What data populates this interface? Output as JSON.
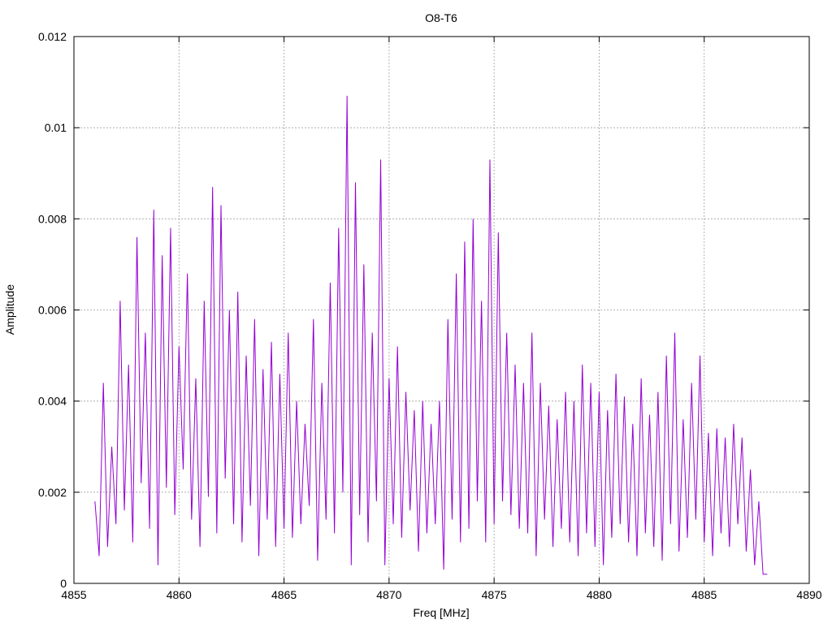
{
  "chart_data": {
    "type": "line",
    "title": "O8-T6",
    "xlabel": "Freq [MHz]",
    "ylabel": "Amplitude",
    "xlim": [
      4855,
      4890
    ],
    "ylim": [
      0,
      0.012
    ],
    "xticks": [
      4855,
      4860,
      4865,
      4870,
      4875,
      4880,
      4885,
      4890
    ],
    "xtick_labels": [
      "4855",
      "4860",
      "4865",
      "4870",
      "4875",
      "4880",
      "4885",
      "4890"
    ],
    "yticks": [
      0,
      0.002,
      0.004,
      0.006,
      0.008,
      0.01,
      0.012
    ],
    "ytick_labels": [
      "0",
      "0.002",
      "0.004",
      "0.006",
      "0.008",
      "0.01",
      "0.012"
    ],
    "grid": true,
    "legend": "none",
    "series": [
      {
        "color": "#9400d3",
        "x": [
          4856.0,
          4856.2,
          4856.4,
          4856.6,
          4856.8,
          4857.0,
          4857.2,
          4857.4,
          4857.6,
          4857.8,
          4858.0,
          4858.2,
          4858.4,
          4858.6,
          4858.8,
          4859.0,
          4859.2,
          4859.4,
          4859.6,
          4859.8,
          4860.0,
          4860.2,
          4860.4,
          4860.6,
          4860.8,
          4861.0,
          4861.2,
          4861.4,
          4861.6,
          4861.8,
          4862.0,
          4862.2,
          4862.4,
          4862.6,
          4862.8,
          4863.0,
          4863.2,
          4863.4,
          4863.6,
          4863.8,
          4864.0,
          4864.2,
          4864.4,
          4864.6,
          4864.8,
          4865.0,
          4865.2,
          4865.4,
          4865.6,
          4865.8,
          4866.0,
          4866.2,
          4866.4,
          4866.6,
          4866.8,
          4867.0,
          4867.2,
          4867.4,
          4867.6,
          4867.8,
          4868.0,
          4868.2,
          4868.4,
          4868.6,
          4868.8,
          4869.0,
          4869.2,
          4869.4,
          4869.6,
          4869.8,
          4870.0,
          4870.2,
          4870.4,
          4870.6,
          4870.8,
          4871.0,
          4871.2,
          4871.4,
          4871.6,
          4871.8,
          4872.0,
          4872.2,
          4872.4,
          4872.6,
          4872.8,
          4873.0,
          4873.2,
          4873.4,
          4873.6,
          4873.8,
          4874.0,
          4874.2,
          4874.4,
          4874.6,
          4874.8,
          4875.0,
          4875.2,
          4875.4,
          4875.6,
          4875.8,
          4876.0,
          4876.2,
          4876.4,
          4876.6,
          4876.8,
          4877.0,
          4877.2,
          4877.4,
          4877.6,
          4877.8,
          4878.0,
          4878.2,
          4878.4,
          4878.6,
          4878.8,
          4879.0,
          4879.2,
          4879.4,
          4879.6,
          4879.8,
          4880.0,
          4880.2,
          4880.4,
          4880.6,
          4880.8,
          4881.0,
          4881.2,
          4881.4,
          4881.6,
          4881.8,
          4882.0,
          4882.2,
          4882.4,
          4882.6,
          4882.8,
          4883.0,
          4883.2,
          4883.4,
          4883.6,
          4883.8,
          4884.0,
          4884.2,
          4884.4,
          4884.6,
          4884.8,
          4885.0,
          4885.2,
          4885.4,
          4885.6,
          4885.8,
          4886.0,
          4886.2,
          4886.4,
          4886.6,
          4886.8,
          4887.0,
          4887.2,
          4887.4,
          4887.6,
          4887.8,
          4888.0
        ],
        "y": [
          0.0018,
          0.0006,
          0.0044,
          0.0008,
          0.003,
          0.0013,
          0.0062,
          0.0016,
          0.0048,
          0.0009,
          0.0076,
          0.0022,
          0.0055,
          0.0012,
          0.0082,
          0.0004,
          0.0072,
          0.0021,
          0.0078,
          0.0015,
          0.0052,
          0.0025,
          0.0068,
          0.0014,
          0.0045,
          0.0008,
          0.0062,
          0.0019,
          0.0087,
          0.0011,
          0.0083,
          0.0023,
          0.006,
          0.0013,
          0.0064,
          0.0009,
          0.005,
          0.0017,
          0.0058,
          0.0006,
          0.0047,
          0.0014,
          0.0053,
          0.0008,
          0.0046,
          0.0012,
          0.0055,
          0.001,
          0.004,
          0.0013,
          0.0035,
          0.0017,
          0.0058,
          0.0005,
          0.0044,
          0.0014,
          0.0066,
          0.0011,
          0.0078,
          0.002,
          0.0107,
          0.0004,
          0.0088,
          0.0015,
          0.007,
          0.0009,
          0.0055,
          0.0018,
          0.0093,
          0.0004,
          0.0045,
          0.0013,
          0.0052,
          0.001,
          0.0042,
          0.0016,
          0.0038,
          0.0007,
          0.004,
          0.0011,
          0.0035,
          0.0013,
          0.004,
          0.0003,
          0.0058,
          0.0014,
          0.0068,
          0.0009,
          0.0075,
          0.0012,
          0.008,
          0.0018,
          0.0062,
          0.0009,
          0.0093,
          0.0013,
          0.0077,
          0.0018,
          0.0055,
          0.0015,
          0.0048,
          0.0012,
          0.0044,
          0.0011,
          0.0055,
          0.0006,
          0.0044,
          0.0014,
          0.0039,
          0.0008,
          0.0036,
          0.0012,
          0.0042,
          0.0009,
          0.004,
          0.0006,
          0.0048,
          0.0011,
          0.0044,
          0.0008,
          0.0042,
          0.0004,
          0.0038,
          0.001,
          0.0046,
          0.0013,
          0.0041,
          0.0009,
          0.0035,
          0.0006,
          0.0045,
          0.0011,
          0.0037,
          0.0008,
          0.0042,
          0.0005,
          0.005,
          0.0013,
          0.0055,
          0.0007,
          0.0036,
          0.001,
          0.0044,
          0.0014,
          0.005,
          0.0009,
          0.0033,
          0.0006,
          0.0034,
          0.0011,
          0.0032,
          0.0008,
          0.0035,
          0.0013,
          0.0032,
          0.0007,
          0.0025,
          0.0004,
          0.0018,
          0.0002,
          0.0002
        ]
      }
    ]
  }
}
